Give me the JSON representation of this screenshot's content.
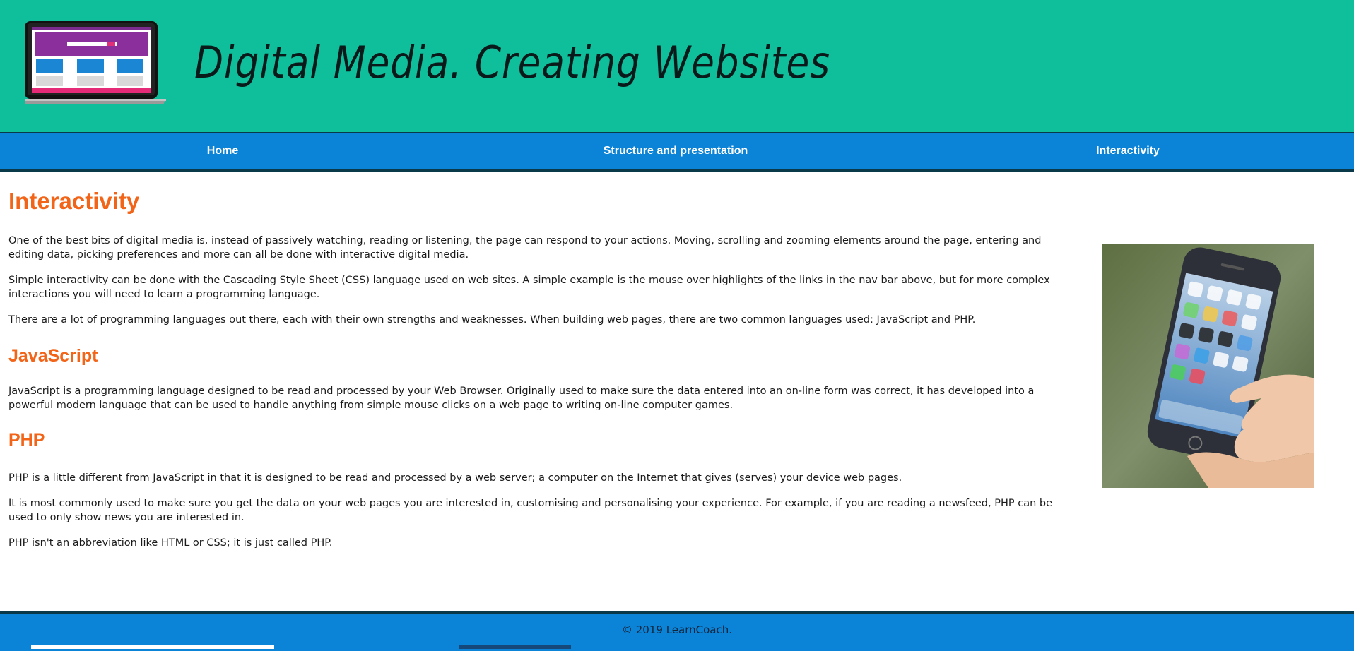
{
  "header": {
    "title": "Digital Media. Creating Websites",
    "logo_icon": "laptop-website-icon",
    "background": "#0fbf9b"
  },
  "nav": {
    "items": [
      {
        "label": "Home"
      },
      {
        "label": "Structure and presentation"
      },
      {
        "label": "Interactivity"
      }
    ],
    "background": "#0b84d8"
  },
  "main": {
    "heading": "Interactivity",
    "intro": [
      "One of the best bits of digital media is, instead of passively watching, reading or listening, the page can respond to your actions. Moving, scrolling and zooming elements around the page, entering and editing data, picking preferences and more can all be done with interactive digital media.",
      "Simple interactivity can be done with the Cascading Style Sheet (CSS) language used on web sites. A simple example is the mouse over highlights of the links in the nav bar above, but for more complex interactions you will need to learn a programming language.",
      "There are a lot of programming languages out there, each with their own strengths and weaknesses. When building web pages, there are two common languages used: JavaScript and PHP."
    ],
    "javascript": {
      "heading": "JavaScript",
      "paragraph": "JavaScript is a programming language designed to be read and processed by your Web Browser. Originally used to make sure the data entered into an on-line form was correct, it has developed into a powerful modern language that can be used to handle anything from simple mouse clicks on a web page to writing on-line computer games."
    },
    "php": {
      "heading": "PHP",
      "paragraphs": [
        "PHP is a little different from JavaScript in that it is designed to be read and processed by a web server; a computer on the Internet that gives (serves) your device web pages.",
        "It is most commonly used to make sure you get the data on your web pages you are interested in, customising and personalising your experience. For example, if you are reading a newsfeed, PHP can be used to only show news you are interested in.",
        "PHP isn't an abbreviation like HTML or CSS; it is just called PHP."
      ]
    },
    "heading_color": "#f26418",
    "image_icon": "hand-holding-smartphone-image"
  },
  "footer": {
    "copyright": "© 2019 LearnCoach."
  }
}
